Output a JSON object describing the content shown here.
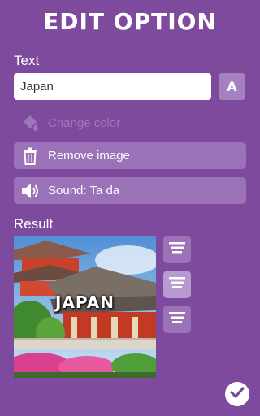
{
  "header": {
    "title": "Edit option"
  },
  "text_section": {
    "label": "Text",
    "input_value": "Japan",
    "font_button_label": "A"
  },
  "change_color": {
    "label": "Change color",
    "enabled": false
  },
  "remove_image": {
    "label": "Remove image"
  },
  "sound": {
    "label": "Sound: Ta da"
  },
  "result": {
    "label": "Result",
    "caption": "JAPAN",
    "alignment": [
      "top",
      "middle",
      "bottom"
    ],
    "selected_alignment": "middle"
  },
  "colors": {
    "background": "#7d4a9e",
    "button": "#9b72b8",
    "button_active": "#b79ad0",
    "confirm_check": "#7d4a9e"
  },
  "icons": [
    "paint-bucket-icon",
    "trash-icon",
    "speaker-icon",
    "align-top-icon",
    "align-middle-icon",
    "align-bottom-icon",
    "checkmark-icon"
  ]
}
